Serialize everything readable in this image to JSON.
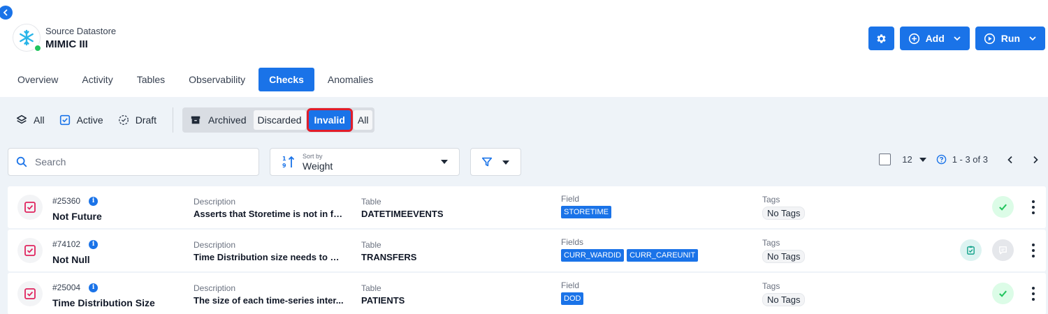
{
  "header": {
    "datastore_kind": "Source Datastore",
    "datastore_name": "MIMIC III",
    "status_color": "#22c55e"
  },
  "actions": {
    "add_label": "Add",
    "run_label": "Run"
  },
  "tabs": [
    "Overview",
    "Activity",
    "Tables",
    "Observability",
    "Checks",
    "Anomalies"
  ],
  "active_tab": "Checks",
  "status_filters": {
    "all": "All",
    "active": "Active",
    "draft": "Draft",
    "archived": "Archived",
    "discarded": "Discarded",
    "invalid": "Invalid",
    "archived_all": "All"
  },
  "search": {
    "placeholder": "Search"
  },
  "sort": {
    "label": "Sort by",
    "value": "Weight"
  },
  "pager": {
    "per_page": "12",
    "range": "1 - 3 of 3"
  },
  "checks": [
    {
      "id": "#25360",
      "name": "Not Future",
      "description_label": "Description",
      "description": "Asserts that Storetime is not in fu...",
      "table_label": "Table",
      "table": "DATETIMEEVENTS",
      "field_label": "Field",
      "fields": [
        "STORETIME"
      ],
      "tags_label": "Tags",
      "tags": "No Tags"
    },
    {
      "id": "#74102",
      "name": "Not Null",
      "description_label": "Description",
      "description": "Time Distribution size needs to be...",
      "table_label": "Table",
      "table": "TRANSFERS",
      "field_label": "Fields",
      "fields": [
        "CURR_WARDID",
        "CURR_CAREUNIT"
      ],
      "tags_label": "Tags",
      "tags": "No Tags"
    },
    {
      "id": "#25004",
      "name": "Time Distribution Size",
      "description_label": "Description",
      "description": "The size of each time-series inter...",
      "table_label": "Table",
      "table": "PATIENTS",
      "field_label": "Field",
      "fields": [
        "DOD"
      ],
      "tags_label": "Tags",
      "tags": "No Tags"
    }
  ],
  "colors": {
    "primary": "#1a73e8",
    "highlight_outline": "#e11d2a",
    "check_icon": "#e0245e",
    "success": "#22c55e"
  }
}
